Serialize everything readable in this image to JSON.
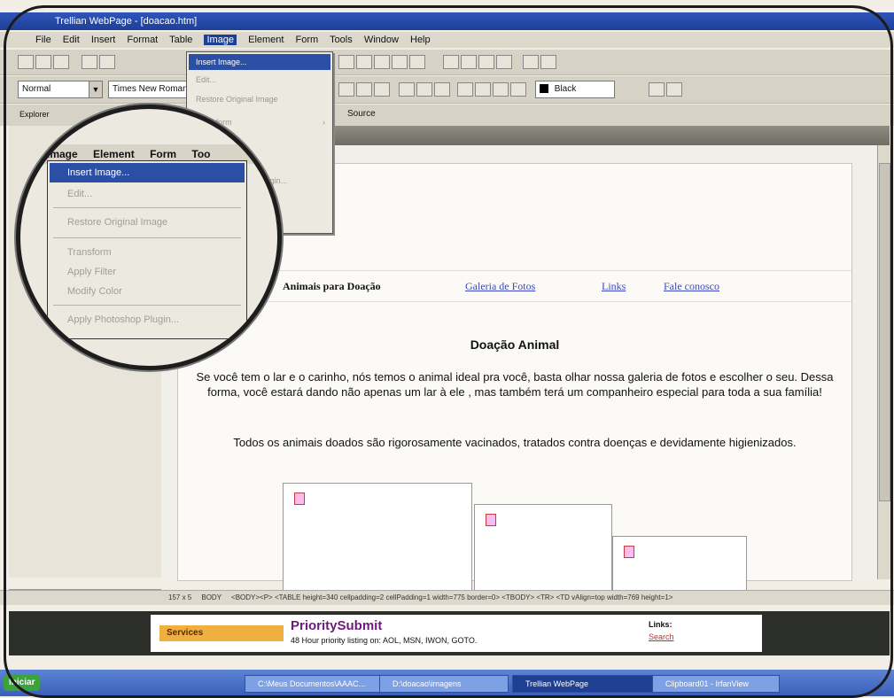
{
  "window": {
    "title": "Trellian WebPage - [doacao.htm]"
  },
  "menubar": [
    "File",
    "Edit",
    "Insert",
    "Format",
    "Table",
    "Image",
    "Element",
    "Form",
    "Tools",
    "Window",
    "Help"
  ],
  "toolbar": {
    "style_select": "Normal",
    "font_select": "Times New Roman",
    "color_select": "Black"
  },
  "tabs": {
    "explorer": "Explorer",
    "source": "Source"
  },
  "image_menu": {
    "items": [
      "Insert Image...",
      "Edit...",
      "Restore Original Image",
      "Transform",
      "Apply Filter",
      "Modify Color",
      "Apply Photoshop Plugin..."
    ]
  },
  "magnifier": {
    "menubar": [
      "Image",
      "Element",
      "Form",
      "Too"
    ],
    "items": [
      "Insert Image...",
      "Edit...",
      "Restore Original Image",
      "Transform",
      "Apply Filter",
      "Modify Color",
      "Apply Photoshop Plugin..."
    ]
  },
  "page": {
    "nav": {
      "item1": "Animais para Doação",
      "item2": "Galeria de Fotos",
      "item3": "Links",
      "item4": "Fale conosco"
    },
    "title": "Doação Animal",
    "para1": "Se você tem o lar e o carinho, nós temos o animal ideal pra você, basta olhar nossa galeria de fotos e escolher o seu. Dessa forma, você estará dando não apenas um lar à ele , mas também terá um companheiro especial para toda a sua família!",
    "para2": "Todos os animais doados são rigorosamente vacinados, tratados contra doenças e devidamente higienizados."
  },
  "statusbar": {
    "size": "157 x 5",
    "tag": "BODY",
    "path": "<BODY><P> <TABLE height=340 cellpadding=2 cellPadding=1 width=775 border=0> <TBODY> <TR> <TD vAlign=top width=769 height=1>"
  },
  "banner": {
    "services": "Services",
    "brand": "PrioritySubmit",
    "tagline": "48 Hour priority listing on: AOL, MSN, IWON, GOTO.",
    "links_label": "Links:",
    "search_link": "Search"
  },
  "taskbar": {
    "start": "Iniciar",
    "tasks": [
      "C:\\Meus Documentos\\AAAC...",
      "D:\\doacao\\imagens",
      "Trellian WebPage",
      "Clipboard01 - IrfanView"
    ]
  }
}
